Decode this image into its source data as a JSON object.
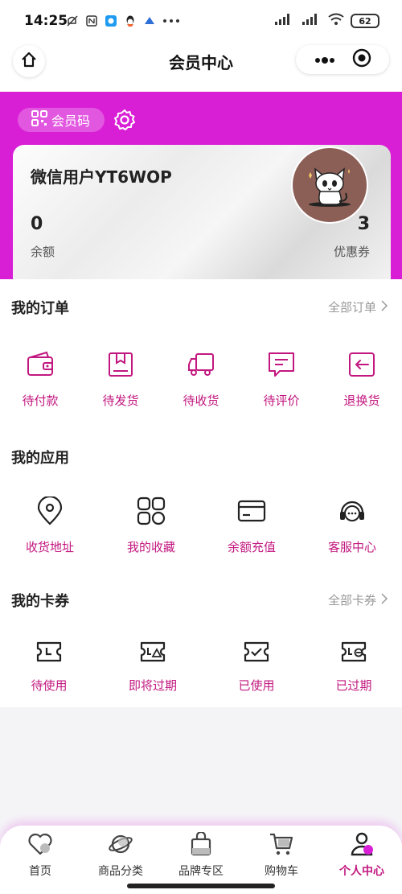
{
  "status": {
    "time": "14:25",
    "battery": "62"
  },
  "nav": {
    "title": "会员中心"
  },
  "member": {
    "code_label": "会员码",
    "name": "微信用户YT6WOP",
    "balance_value": "0",
    "balance_label": "余额",
    "coupon_value": "3",
    "coupon_label": "优惠券"
  },
  "orders": {
    "title": "我的订单",
    "link": "全部订单",
    "items": [
      {
        "label": "待付款",
        "icon": "wallet-icon"
      },
      {
        "label": "待发货",
        "icon": "box-icon"
      },
      {
        "label": "待收货",
        "icon": "truck-icon"
      },
      {
        "label": "待评价",
        "icon": "comment-icon"
      },
      {
        "label": "退换货",
        "icon": "return-icon"
      }
    ]
  },
  "apps": {
    "title": "我的应用",
    "items": [
      {
        "label": "收货地址",
        "icon": "location-icon"
      },
      {
        "label": "我的收藏",
        "icon": "grid-icon"
      },
      {
        "label": "余额充值",
        "icon": "card-icon"
      },
      {
        "label": "客服中心",
        "icon": "headset-icon"
      }
    ]
  },
  "coupons": {
    "title": "我的卡券",
    "link": "全部卡券",
    "items": [
      {
        "label": "待使用",
        "icon": "ticket-clock-icon"
      },
      {
        "label": "即将过期",
        "icon": "ticket-warning-icon"
      },
      {
        "label": "已使用",
        "icon": "ticket-check-icon"
      },
      {
        "label": "已过期",
        "icon": "ticket-expired-icon"
      }
    ]
  },
  "tabs": [
    {
      "label": "首页",
      "icon": "heart-icon"
    },
    {
      "label": "商品分类",
      "icon": "planet-icon"
    },
    {
      "label": "品牌专区",
      "icon": "bag-icon"
    },
    {
      "label": "购物车",
      "icon": "cart-icon"
    },
    {
      "label": "个人中心",
      "icon": "user-icon"
    }
  ],
  "colors": {
    "brand": "#d91fd6",
    "accent_text": "#c2177f"
  }
}
